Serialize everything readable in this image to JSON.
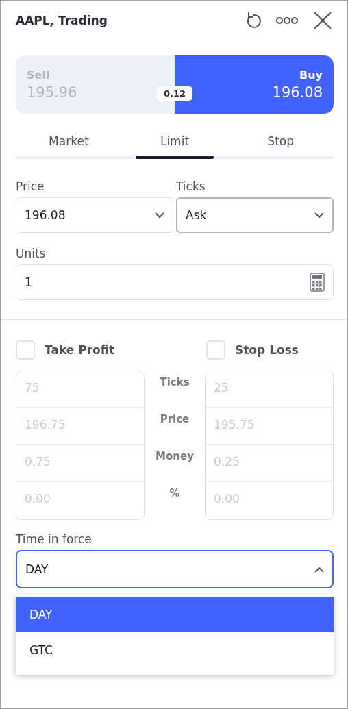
{
  "header": {
    "title": "AAPL, Trading"
  },
  "side": {
    "sell": {
      "label": "Sell",
      "price": "195.96",
      "selected": false
    },
    "buy": {
      "label": "Buy",
      "price": "196.08",
      "selected": true
    },
    "spread": "0.12"
  },
  "order_tabs": [
    {
      "label": "Market",
      "selected": false
    },
    {
      "label": "Limit",
      "selected": true
    },
    {
      "label": "Stop",
      "selected": false
    }
  ],
  "price_field": {
    "label": "Price",
    "value": "196.08"
  },
  "ticks_field": {
    "label": "Ticks",
    "value": "Ask"
  },
  "units_field": {
    "label": "Units",
    "value": "1"
  },
  "take_profit": {
    "label": "Take Profit",
    "checked": false,
    "values": [
      "75",
      "196.75",
      "0.75",
      "0.00"
    ]
  },
  "stop_loss": {
    "label": "Stop Loss",
    "checked": false,
    "values": [
      "25",
      "195.75",
      "0.25",
      "0.00"
    ]
  },
  "row_labels": [
    "Ticks",
    "Price",
    "Money",
    "%"
  ],
  "time_in_force": {
    "label": "Time in force",
    "value": "DAY",
    "expanded": true,
    "options": [
      {
        "label": "DAY",
        "selected": true
      },
      {
        "label": "GTC",
        "selected": false
      }
    ]
  }
}
